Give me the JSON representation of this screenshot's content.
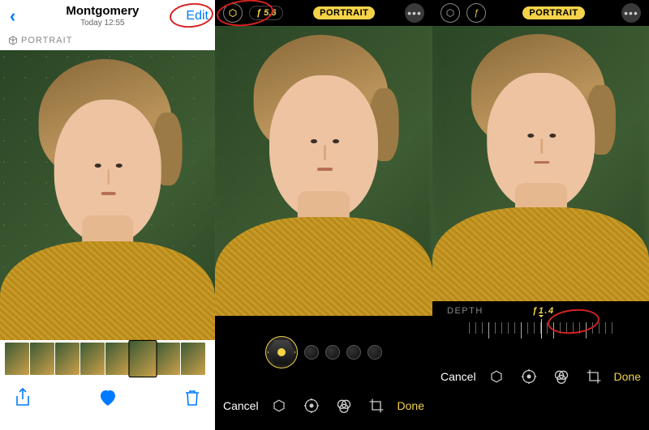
{
  "screen1": {
    "title": "Montgomery",
    "subtitle": "Today  12:55",
    "edit_label": "Edit",
    "portrait_tag": "PORTRAIT"
  },
  "screen2": {
    "f_value": "ƒ 5.6",
    "portrait_tag": "PORTRAIT",
    "cancel_label": "Cancel",
    "done_label": "Done"
  },
  "screen3": {
    "portrait_tag": "PORTRAIT",
    "depth_label": "DEPTH",
    "depth_value": "ƒ1.4",
    "cancel_label": "Cancel",
    "done_label": "Done"
  },
  "colors": {
    "accent": "#f4d34a",
    "ios_blue": "#007aff",
    "annotation": "#d62222"
  }
}
